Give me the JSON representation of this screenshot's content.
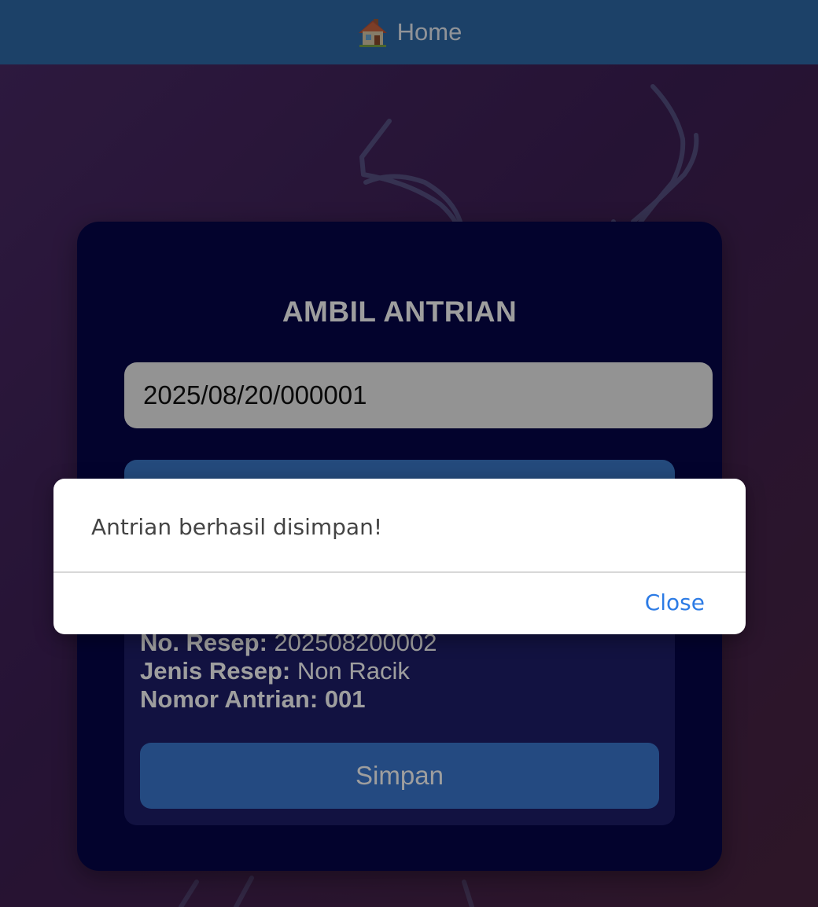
{
  "header": {
    "home_label": "Home",
    "home_icon": "house-icon"
  },
  "form": {
    "title": "AMBIL ANTRIAN",
    "recipe_input_value": "2025/08/20/000001"
  },
  "result": {
    "recipe_no_label": "No. Resep:",
    "recipe_no_value": "202508200002",
    "recipe_type_label": "Jenis Resep:",
    "recipe_type_value": "Non Racik",
    "queue_no_label": "Nomor Antrian:",
    "queue_no_value": "001",
    "save_label": "Simpan"
  },
  "modal": {
    "message": "Antrian berhasil disimpan!",
    "close_label": "Close"
  },
  "colors": {
    "header": "#2e6aa8",
    "card": "#06064a",
    "button": "#3a78d0",
    "link": "#2c7be5"
  }
}
